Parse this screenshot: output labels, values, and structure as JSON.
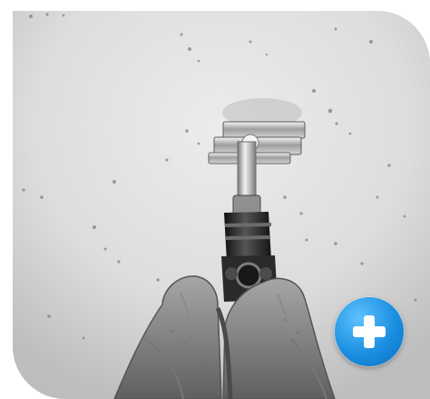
{
  "image": {
    "subject": "",
    "grayscale": true
  },
  "actions": {
    "expand_icon": "plus-icon",
    "accent": "#1a8fe0"
  }
}
